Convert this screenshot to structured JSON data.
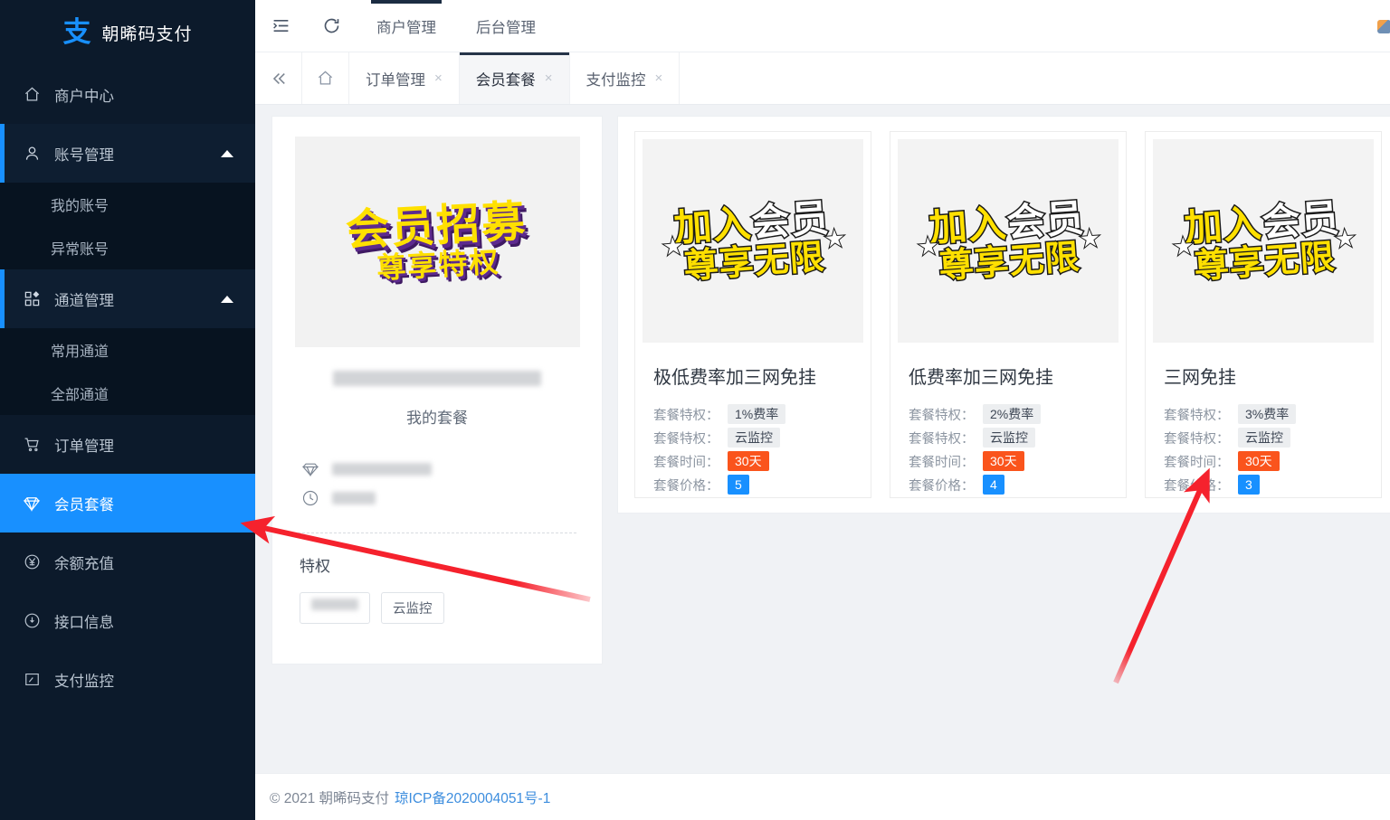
{
  "brand": {
    "logo": "支",
    "name": "朝晞码支付"
  },
  "sidebar": {
    "items": [
      {
        "label": "商户中心",
        "icon": "home-icon",
        "type": "item"
      },
      {
        "label": "账号管理",
        "icon": "user-icon",
        "type": "group",
        "expanded": true,
        "children": [
          {
            "label": "我的账号"
          },
          {
            "label": "异常账号"
          }
        ]
      },
      {
        "label": "通道管理",
        "icon": "grid-icon",
        "type": "group",
        "expanded": true,
        "children": [
          {
            "label": "常用通道"
          },
          {
            "label": "全部通道"
          }
        ]
      },
      {
        "label": "订单管理",
        "icon": "cart-icon",
        "type": "item"
      },
      {
        "label": "会员套餐",
        "icon": "diamond-icon",
        "type": "item",
        "active": true
      },
      {
        "label": "余额充值",
        "icon": "yen-icon",
        "type": "item"
      },
      {
        "label": "接口信息",
        "icon": "info-icon",
        "type": "item"
      },
      {
        "label": "支付监控",
        "icon": "monitor-icon",
        "type": "item"
      }
    ]
  },
  "topbar": {
    "collapse_icon": "menu-fold-icon",
    "refresh_icon": "refresh-icon",
    "nav": [
      {
        "label": "商户管理",
        "active": true
      },
      {
        "label": "后台管理",
        "active": false
      }
    ]
  },
  "tabbar": {
    "collapse_icon": "double-chevron-left-icon",
    "home_icon": "home-icon",
    "tabs": [
      {
        "label": "订单管理",
        "active": false,
        "close": "×"
      },
      {
        "label": "会员套餐",
        "active": true,
        "close": "×"
      },
      {
        "label": "支付监控",
        "active": false,
        "close": "×"
      }
    ]
  },
  "my_plan_card": {
    "banner": {
      "line1": "会员招募",
      "line2": "尊享特权"
    },
    "account_name_redacted": true,
    "title": "我的套餐",
    "rows": [
      {
        "icon": "diamond-icon",
        "value_redacted": true
      },
      {
        "icon": "clock-icon",
        "value_redacted": true
      }
    ],
    "privilege_label": "特权",
    "tags": [
      {
        "label": "",
        "redacted": true
      },
      {
        "label": "云监控",
        "redacted": false
      }
    ]
  },
  "packages": {
    "banner": {
      "part_yellow": "加入",
      "part_white": "会员",
      "line2": "尊享无限"
    },
    "labels": {
      "privilege": "套餐特权：",
      "duration": "套餐时间：",
      "price": "套餐价格："
    },
    "items": [
      {
        "title": "极低费率加三网免挂",
        "privilege1": "1%费率",
        "privilege2": "云监控",
        "duration": "30天",
        "price": "5"
      },
      {
        "title": "低费率加三网免挂",
        "privilege1": "2%费率",
        "privilege2": "云监控",
        "duration": "30天",
        "price": "4"
      },
      {
        "title": "三网免挂",
        "privilege1": "3%费率",
        "privilege2": "云监控",
        "duration": "30天",
        "price": "3"
      }
    ]
  },
  "footer": {
    "copyright": "© 2021 朝晞码支付",
    "icp": "琼ICP备2020004051号-1"
  },
  "annotations": {
    "arrow_color": "#f5222d",
    "arrow1_target": "会员套餐 sidebar item",
    "arrow2_target": "三网免挂 套餐价格 3"
  },
  "colors": {
    "sidebar_bg": "#0c1a2b",
    "accent": "#1890ff",
    "orange": "#fa541c",
    "link": "#3c8dde"
  }
}
